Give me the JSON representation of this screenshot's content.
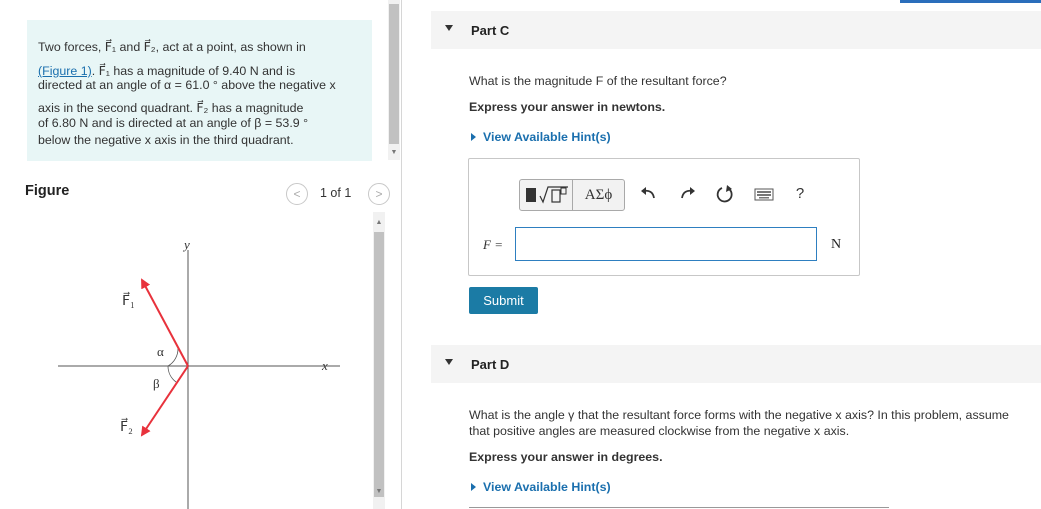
{
  "problem": {
    "line1": "Two forces, F⃗₁ and F⃗₂, act at a point, as shown in",
    "figure_link": "(Figure 1)",
    "line2_rest": ". F⃗₁ has a magnitude of 9.40 N and is",
    "line3": "directed at an angle of α = 61.0 °  above the negative x",
    "line4": "axis in the second quadrant. F⃗₂ has a magnitude",
    "line5": "of 6.80 N and is directed at an angle of β = 53.9 °",
    "line6": "below the negative x axis in the third quadrant."
  },
  "figure": {
    "title": "Figure",
    "pager_label": "1 of 1",
    "prev_icon": "chevron-left-icon",
    "next_icon": "chevron-right-icon",
    "labels": {
      "y": "y",
      "x": "x",
      "f1": "F⃗₁",
      "f2": "F⃗₂",
      "alpha": "α",
      "beta": "β"
    },
    "colors": {
      "vector": "#e8323c",
      "axis": "#555555"
    }
  },
  "partC": {
    "title": "Part C",
    "question": "What is the magnitude F of the resultant force?",
    "express": "Express your answer in newtons.",
    "hint": "View Available Hint(s)",
    "toolbar": {
      "template_icon": "radical-template-icon",
      "greek_label": "ΑΣϕ",
      "undo_icon": "undo-icon",
      "redo_icon": "redo-icon",
      "reset_icon": "reset-icon",
      "keyboard_icon": "keyboard-icon",
      "help_label": "?"
    },
    "input_label": "F =",
    "input_value": "",
    "unit": "N",
    "submit_label": "Submit"
  },
  "partD": {
    "title": "Part D",
    "question_line1": "What is the angle γ that the resultant force forms with the negative x axis? In this problem, assume",
    "question_line2": "that positive angles are measured  clockwise from the negative x axis.",
    "express": "Express your answer in degrees.",
    "hint": "View Available Hint(s)"
  },
  "colors": {
    "accent": "#1a6fae",
    "submit_bg": "#1b7ba5",
    "problem_bg": "#e8f6f6",
    "input_border": "#2e7fc0"
  }
}
